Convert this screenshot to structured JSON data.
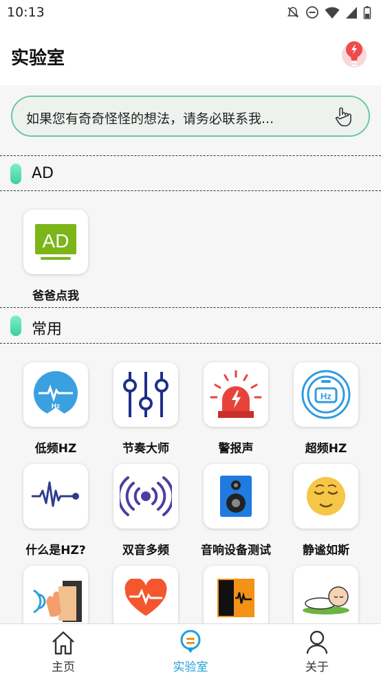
{
  "status_bar": {
    "time": "10:13"
  },
  "header": {
    "title": "实验室"
  },
  "banner": {
    "text": "如果您有奇奇怪怪的想法，请务必联系我..."
  },
  "sections": {
    "ad": {
      "title": "AD",
      "items": [
        {
          "label": "爸爸点我",
          "icon": "ad-icon"
        }
      ]
    },
    "common": {
      "title": "常用",
      "items": [
        {
          "label": "低频HZ",
          "icon": "low-frequency-icon"
        },
        {
          "label": "节奏大师",
          "icon": "equalizer-icon"
        },
        {
          "label": "警报声",
          "icon": "siren-icon"
        },
        {
          "label": "超频HZ",
          "icon": "high-frequency-icon"
        },
        {
          "label": "什么是HZ?",
          "icon": "waveform-icon"
        },
        {
          "label": "双音多频",
          "icon": "vibration-icon"
        },
        {
          "label": "音响设备测试",
          "icon": "speaker-icon"
        },
        {
          "label": "静谧如斯",
          "icon": "calm-face-icon"
        },
        {
          "label": "",
          "icon": "ear-listen-icon"
        },
        {
          "label": "",
          "icon": "heartbeat-icon"
        },
        {
          "label": "",
          "icon": "voice-recorder-icon"
        },
        {
          "label": "",
          "icon": "sleeping-baby-icon"
        }
      ]
    }
  },
  "bottom_nav": {
    "items": [
      {
        "label": "主页",
        "icon": "home-icon"
      },
      {
        "label": "实验室",
        "icon": "lab-bulb-icon",
        "active": true
      },
      {
        "label": "关于",
        "icon": "person-icon"
      }
    ]
  },
  "colors": {
    "accent": "#1f9fd6",
    "banner_border": "#6cc7a2",
    "section_pill": "#3fcf9a",
    "alert_red": "#e8433b"
  }
}
